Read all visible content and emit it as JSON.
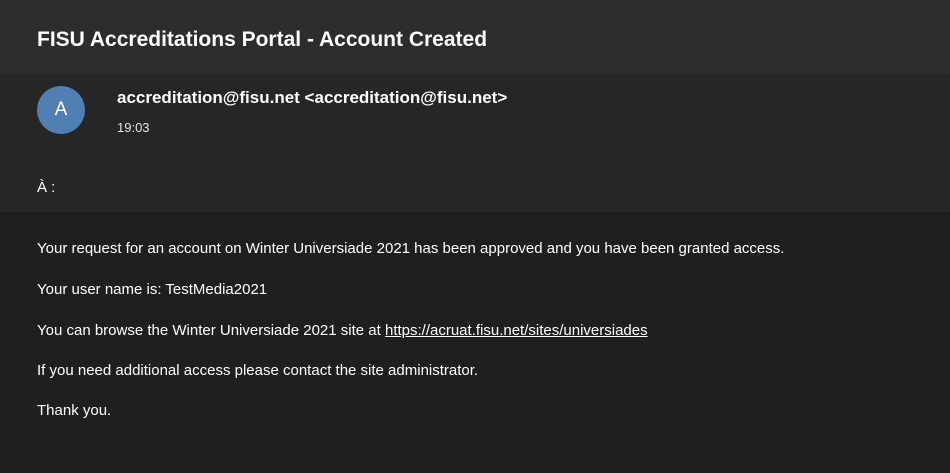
{
  "email": {
    "subject": "FISU Accreditations Portal - Account Created",
    "avatar_letter": "A",
    "sender": "accreditation@fisu.net <accreditation@fisu.net>",
    "time": "19:03",
    "to_label": "À :",
    "body": {
      "line1": "Your request for an account on Winter Universiade 2021 has been approved and you have been granted access.",
      "line2": "Your user name is: TestMedia2021",
      "line3_prefix": "You can browse the Winter Universiade 2021 site at ",
      "line3_link": "https://acruat.fisu.net/sites/universiades",
      "line4": "If you need additional access please contact the site administrator.",
      "line5": "Thank you."
    }
  },
  "colors": {
    "background": "#262626",
    "body_background": "#1f1f1f",
    "avatar": "#4f7fb3",
    "text": "#ffffff"
  }
}
